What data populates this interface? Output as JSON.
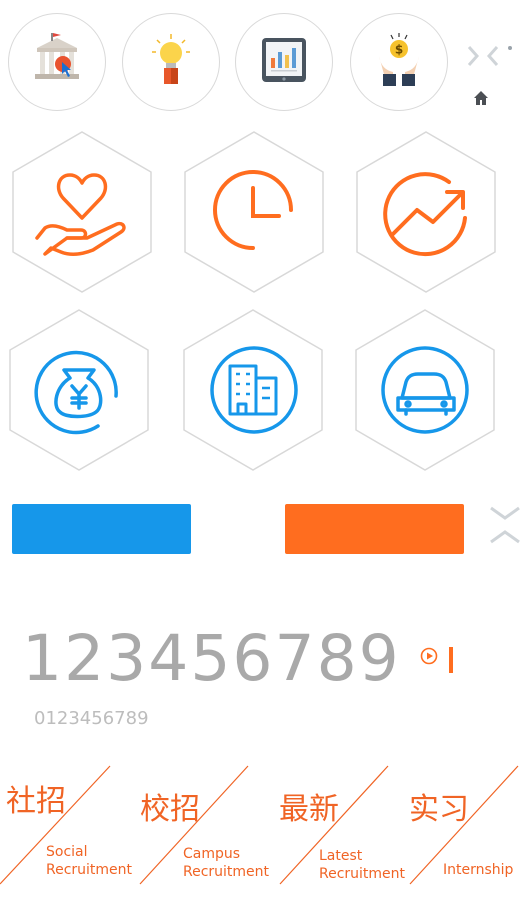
{
  "numbers": {
    "large": "123456789",
    "small": "0123456789"
  },
  "bottom_nav": [
    {
      "cn": "社招",
      "en_line1": "Social",
      "en_line2": "Recruitment"
    },
    {
      "cn": "校招",
      "en_line1": "Campus",
      "en_line2": "Recruitment"
    },
    {
      "cn": "最新",
      "en_line1": "Latest",
      "en_line2": "Recruitment"
    },
    {
      "cn": "实习",
      "en_line1": "",
      "en_line2": "Internship"
    }
  ],
  "icons": {
    "top": [
      "bank-building-icon",
      "idea-lightbulb-icon",
      "tablet-report-icon",
      "money-hands-icon"
    ],
    "hex_orange": [
      "heart-in-hand-icon",
      "clock-icon",
      "growth-arrow-icon"
    ],
    "hex_blue": [
      "money-bag-icon",
      "buildings-icon",
      "car-icon"
    ],
    "misc": [
      "chevron-pair-icon",
      "home-icon",
      "double-chevron-icon",
      "play-icon",
      "cursor-bar-icon"
    ]
  },
  "colors": {
    "orange": "#ff6d1f",
    "blue": "#1697ea",
    "gray_text": "#a9a9a9",
    "hex_border": "#d8d8d8"
  }
}
